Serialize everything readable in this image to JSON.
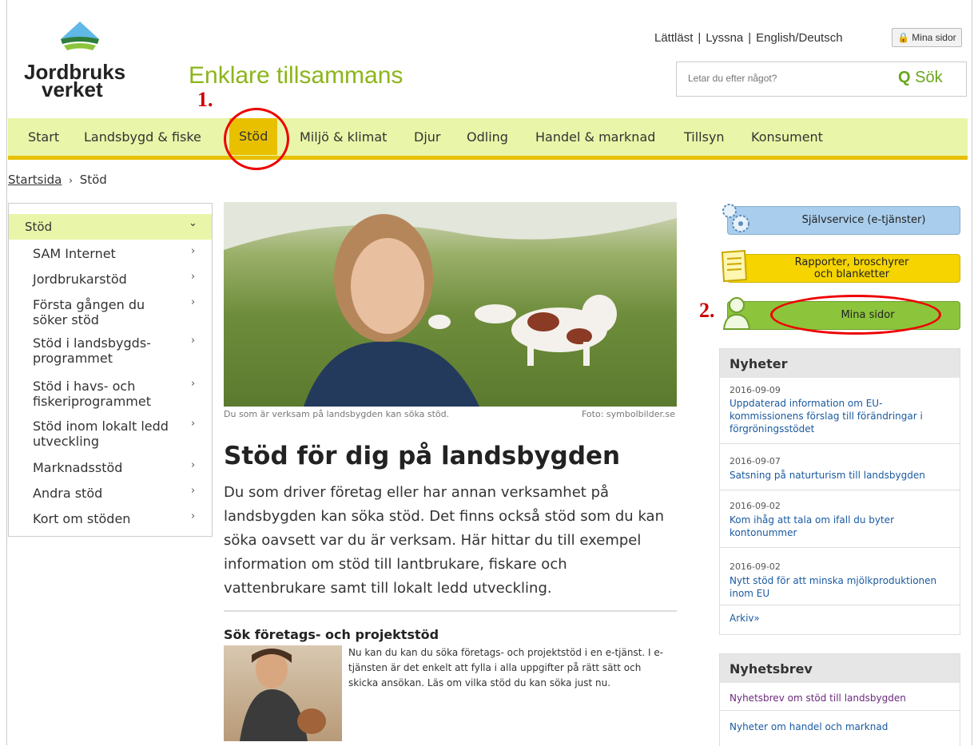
{
  "header": {
    "logo_line1": "Jordbruks",
    "logo_line2": "verket",
    "tagline": "Enklare tillsammans",
    "links": [
      "Lättläst",
      "Lyssna",
      "English/Deutsch"
    ],
    "mina_sidor": "Mina sidor",
    "search_placeholder": "Letar du efter något?",
    "search_label": "Sök"
  },
  "nav": {
    "items": [
      "Start",
      "Landsbygd & fiske",
      "Stöd",
      "Miljö & klimat",
      "Djur",
      "Odling",
      "Handel & marknad",
      "Tillsyn",
      "Konsument"
    ],
    "active": "Stöd"
  },
  "breadcrumb": {
    "home": "Startsida",
    "sep": "›",
    "current": "Stöd"
  },
  "sidebar": {
    "title": "Stöd",
    "title_arrow": "⌄",
    "items": [
      {
        "label": "SAM Internet"
      },
      {
        "label": "Jordbrukarstöd"
      },
      {
        "label": "Första gången du söker stöd"
      },
      {
        "label": "Stöd i landsbygds- programmet"
      },
      {
        "label": "Stöd i havs- och fiskeriprogrammet"
      },
      {
        "label": "Stöd inom lokalt ledd utveckling"
      },
      {
        "label": "Marknadsstöd"
      },
      {
        "label": "Andra stöd"
      },
      {
        "label": "Kort om stöden"
      }
    ],
    "arrow": "›"
  },
  "main": {
    "caption": "Du som är verksam på landsbygden kan söka stöd.",
    "photo_credit": "Foto: symbolbilder.se",
    "heading": "Stöd för dig på landsbygden",
    "lead": "Du som driver företag eller har annan verksamhet på landsbygden kan söka stöd. Det finns också stöd som du kan söka oavsett var du är verksam. Här hittar du till exempel information om stöd till lantbrukare, fiskare och vattenbrukare samt till lokalt ledd utveckling.",
    "sub_heading": "Sök företags- och projektstöd",
    "sub_text": "Nu kan du kan du söka företags- och projektstöd i en e-tjänst. I e-tjänsten är det enkelt att fylla i alla uppgifter på rätt sätt och skicka ansökan. Läs om vilka stöd du kan söka just nu."
  },
  "right": {
    "services": [
      {
        "label": "Självservice (e-tjänster)",
        "color": "#a9cdec"
      },
      {
        "label": "Rapporter, broschyrer och blanketter",
        "color": "#f5d400"
      },
      {
        "label": "Mina sidor",
        "color": "#8cc43c"
      }
    ],
    "news_title": "Nyheter",
    "news": [
      {
        "date": "2016-09-09",
        "text": "Uppdaterad information om EU-kommissionens förslag till förändringar i förgröningsstödet"
      },
      {
        "date": "2016-09-07",
        "text": "Satsning på naturturism till landsbygden"
      },
      {
        "date": "2016-09-02",
        "text": "Kom ihåg att tala om ifall du byter kontonummer"
      },
      {
        "date": "2016-09-02",
        "text": "Nytt stöd för att minska mjölkproduktionen inom EU"
      }
    ],
    "archive": "Arkiv»",
    "newsletter_title": "Nyhetsbrev",
    "newsletter": [
      "Nyhetsbrev om stöd till landsbygden",
      "Nyheter om handel och marknad"
    ]
  },
  "annotations": {
    "first": "1.",
    "second": "2."
  },
  "colors": {
    "nav_bg": "#e9f5a8",
    "accent_yellow": "#e8c000",
    "brand_green": "#8cb51a",
    "marker_red": "#e00000"
  }
}
